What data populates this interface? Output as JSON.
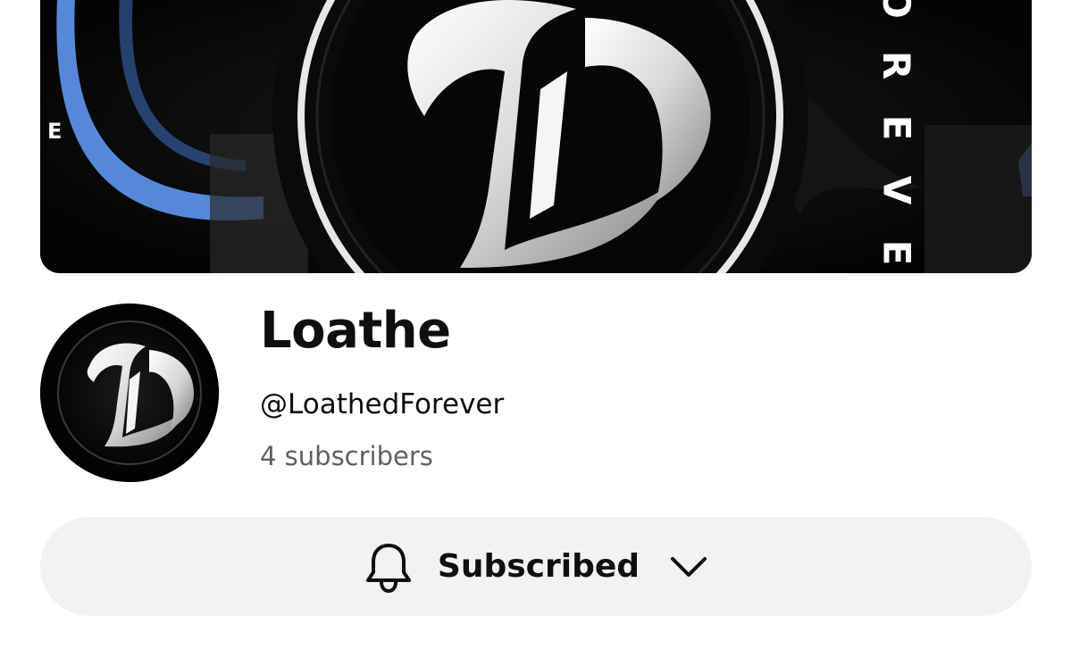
{
  "banner": {
    "left_letter": "E",
    "vertical_letters": [
      "O",
      "R",
      "E",
      "V",
      "E"
    ]
  },
  "channel": {
    "name": "Loathe",
    "handle": "@LoathedForever",
    "subscribers": "4 subscribers"
  },
  "subscribe_button": {
    "label": "Subscribed",
    "icon": "bell-icon",
    "dropdown_icon": "chevron-down-icon"
  },
  "colors": {
    "banner_accent": "#5b8fe6",
    "button_bg": "#f2f2f2",
    "muted_text": "#606060"
  }
}
